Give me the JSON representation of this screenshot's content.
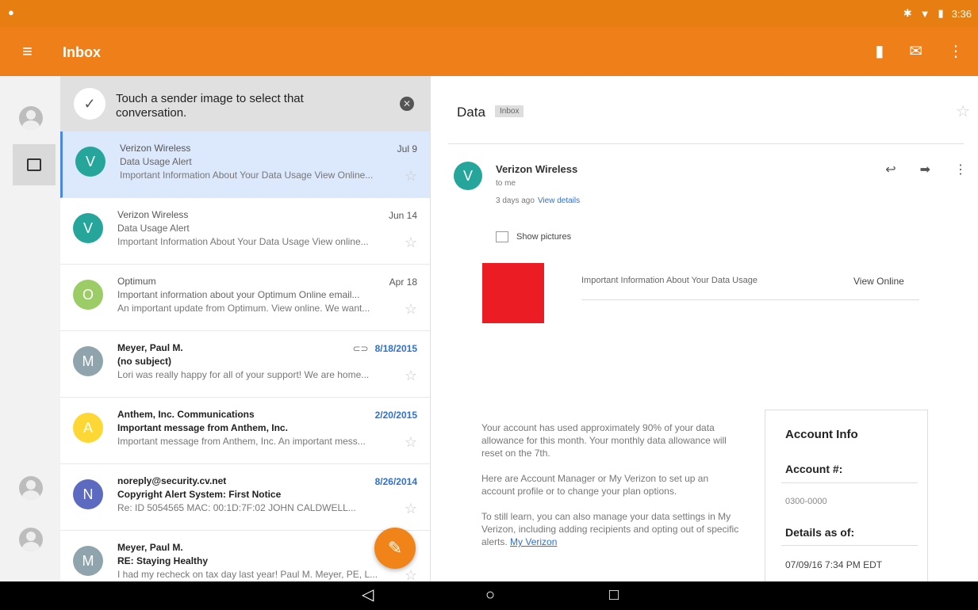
{
  "status_bar": {
    "notification_icon": "location-pin-icon",
    "bluetooth_icon": "bluetooth-icon",
    "wifi_icon": "wifi-icon",
    "battery_icon": "battery-icon",
    "time": "3:36"
  },
  "toolbar": {
    "title": "Inbox",
    "menu_icon": "hamburger-menu-icon",
    "delete_icon": "trash-icon",
    "mark_unread_icon": "envelope-icon",
    "overflow_icon": "more-vert-icon"
  },
  "tip": {
    "message": "Touch a sender image to select that conversation.",
    "check_icon": "check-icon",
    "close_icon": "close-circle-icon"
  },
  "conversations": [
    {
      "initial": "V",
      "color": "#26a69a",
      "sender": "Verizon Wireless",
      "date": "Jul 9",
      "subject": "Data Usage Alert",
      "snippet": "Important Information About Your Data Usage View Online...",
      "selected": true,
      "bold": false
    },
    {
      "initial": "V",
      "color": "#26a69a",
      "sender": "Verizon Wireless",
      "date": "Jun 14",
      "subject": "Data Usage Alert",
      "snippet": "Important Information About Your Data Usage View online...",
      "selected": false,
      "bold": false
    },
    {
      "initial": "O",
      "color": "#9ccc65",
      "sender": "Optimum",
      "date": "Apr 18",
      "subject": "Important information about your Optimum Online email...",
      "snippet": "An important update from Optimum. View online. We want...",
      "selected": false,
      "bold": false
    },
    {
      "initial": "M",
      "color": "#90a4ae",
      "sender": "Meyer, Paul M.",
      "date": "8/18/2015",
      "subject": "(no subject)",
      "snippet": "Lori was really happy for all of your support! We are home...",
      "selected": false,
      "bold": true,
      "attachment": true
    },
    {
      "initial": "A",
      "color": "#fdd835",
      "sender": "Anthem, Inc. Communications",
      "date": "2/20/2015",
      "subject": "Important message from Anthem, Inc.",
      "snippet": "Important message from Anthem, Inc. An important mess...",
      "selected": false,
      "bold": true
    },
    {
      "initial": "N",
      "color": "#5c6bc0",
      "sender": "noreply@security.cv.net",
      "date": "8/26/2014",
      "subject": "Copyright Alert System: First Notice",
      "snippet": "Re: ID 5054565 MAC: 00:1D:7F:02 JOHN CALDWELL...",
      "selected": false,
      "bold": true
    },
    {
      "initial": "M",
      "color": "#90a4ae",
      "sender": "Meyer, Paul M.",
      "date": "",
      "subject": "RE: Staying Healthy",
      "snippet": "I had my recheck on tax day last year! Paul M. Meyer, PE, L...",
      "selected": false,
      "bold": true
    }
  ],
  "reader": {
    "subject": "Data",
    "label": "Inbox",
    "sender_initial": "V",
    "sender_name": "Verizon Wireless",
    "to": "to me",
    "time": "3 days ago",
    "view_details": "View details",
    "show_pictures": "Show pictures",
    "header_text": "Important Information About Your Data Usage",
    "view_online": "View Online",
    "body_paragraphs": [
      "Your account has used approximately 90% of your data allowance for this month. Your monthly data allowance will reset on the 7th.",
      "Here are Account Manager or My Verizon to set up an account profile or to change your plan options.",
      "To still learn, you can also manage your data settings in My Verizon, including adding recipients and opting out of specific alerts."
    ],
    "body_link": "My Verizon",
    "account_info": {
      "title": "Account Info",
      "account_label": "Account #:",
      "account_value": "0300-0000",
      "details_label": "Details as of:",
      "details_value": "07/09/16 7:34 PM EDT"
    }
  },
  "fab_icon": "pencil-icon",
  "nav": {
    "back": "◁",
    "home": "○",
    "recents": "□"
  }
}
